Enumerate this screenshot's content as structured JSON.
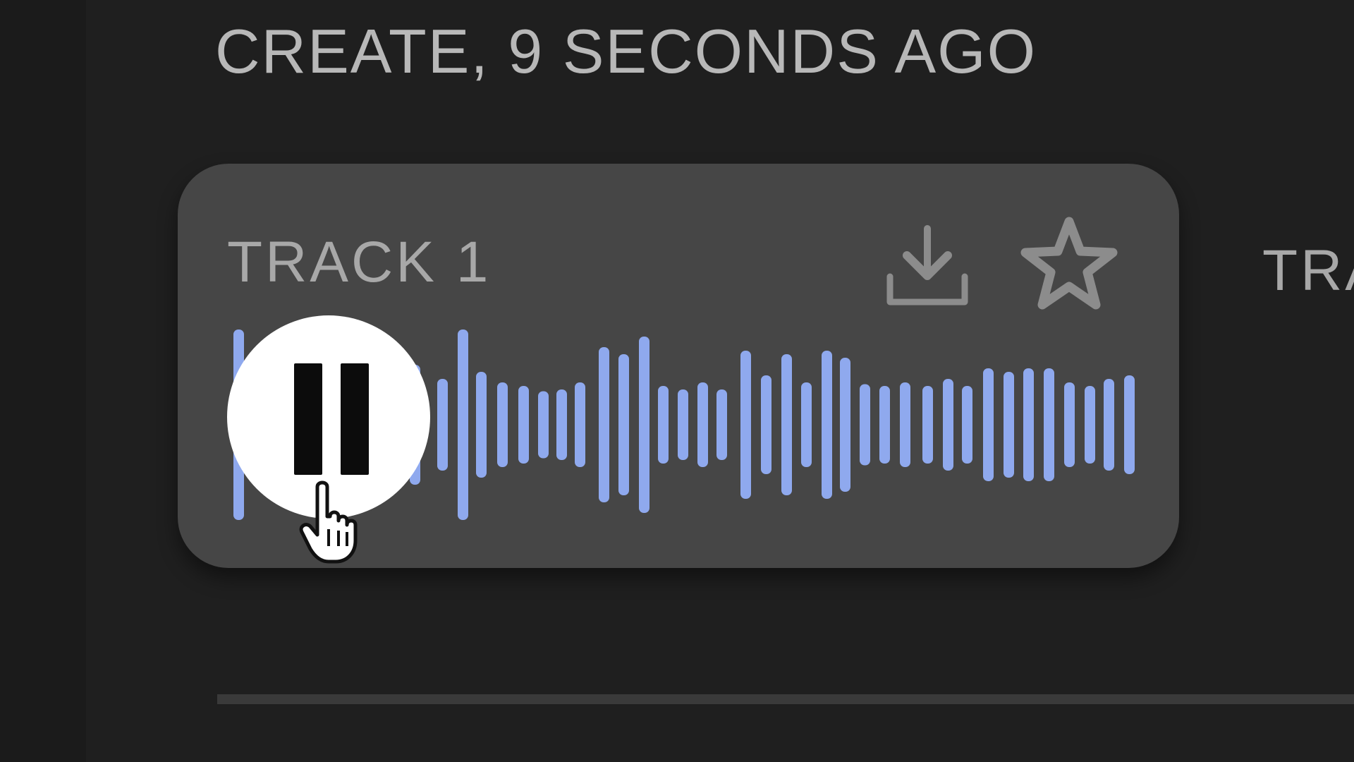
{
  "header": {
    "title": "CREATE, 9 SECONDS AGO"
  },
  "track_card": {
    "title": "TRACK 1",
    "download_icon": "download-icon",
    "favorite_icon": "star-icon",
    "play_state_icon": "pause-icon"
  },
  "next_track_card": {
    "title": "TRA"
  },
  "colors": {
    "background": "#1f1f1f",
    "card": "#464646",
    "waveform": "#8fa9ee",
    "text": "#b8b8b8"
  }
}
